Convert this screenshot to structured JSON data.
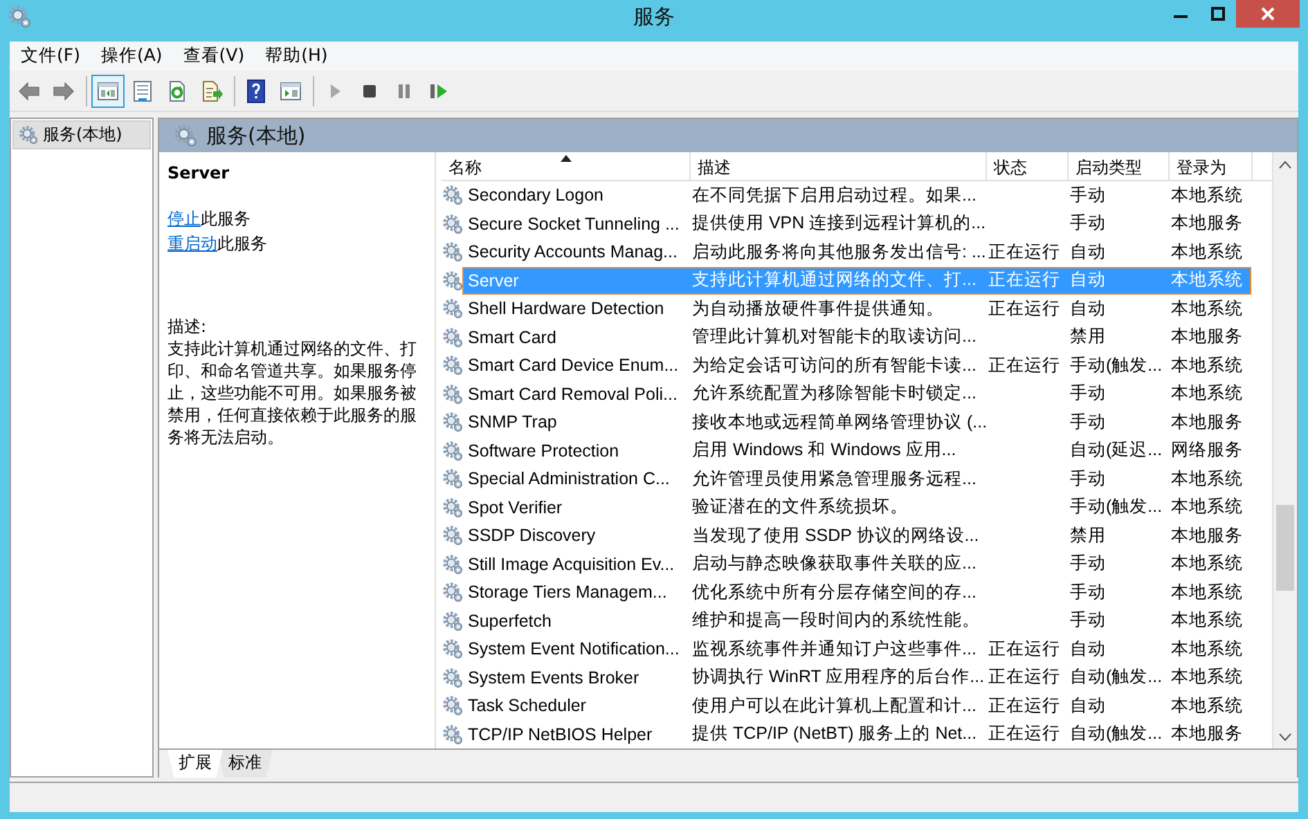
{
  "window": {
    "title": "服务"
  },
  "menu": [
    {
      "label": "文件(F)"
    },
    {
      "label": "操作(A)"
    },
    {
      "label": "查看(V)"
    },
    {
      "label": "帮助(H)"
    }
  ],
  "toolbar": [
    {
      "kind": "back",
      "selected": false
    },
    {
      "kind": "forward",
      "selected": false
    },
    {
      "kind": "tree",
      "selected": true
    },
    {
      "kind": "properties",
      "selected": false
    },
    {
      "kind": "refresh",
      "selected": false
    },
    {
      "kind": "export",
      "selected": false
    },
    {
      "kind": "help",
      "selected": false
    },
    {
      "kind": "console",
      "selected": false
    },
    {
      "kind": "play",
      "selected": false
    },
    {
      "kind": "stop",
      "selected": false
    },
    {
      "kind": "pause",
      "selected": false
    },
    {
      "kind": "resume",
      "selected": false
    }
  ],
  "tree": {
    "items": [
      {
        "label": "服务(本地)",
        "selected": true
      }
    ]
  },
  "panel": {
    "title": "服务(本地)"
  },
  "detail": {
    "service_name": "Server",
    "actions": [
      {
        "link": "停止",
        "text": "此服务"
      },
      {
        "link": "重启动",
        "text": "此服务"
      }
    ],
    "description_label": "描述:",
    "description": "支持此计算机通过网络的文件、打印、和命名管道共享。如果服务停止，这些功能不可用。如果服务被禁用，任何直接依赖于此服务的服务将无法启动。"
  },
  "table": {
    "columns": [
      {
        "label": "名称",
        "sorted": true
      },
      {
        "label": "描述",
        "sorted": false
      },
      {
        "label": "状态",
        "sorted": false
      },
      {
        "label": "启动类型",
        "sorted": false
      },
      {
        "label": "登录为",
        "sorted": false
      }
    ],
    "rows": [
      {
        "name": "Secondary Logon",
        "description": "在不同凭据下启用启动过程。如果...",
        "status": "",
        "startup": "手动",
        "logon": "本地系统",
        "selected": false
      },
      {
        "name": "Secure Socket Tunneling ...",
        "description": "提供使用 VPN 连接到远程计算机的...",
        "status": "",
        "startup": "手动",
        "logon": "本地服务",
        "selected": false
      },
      {
        "name": "Security Accounts Manag...",
        "description": "启动此服务将向其他服务发出信号: ...",
        "status": "正在运行",
        "startup": "自动",
        "logon": "本地系统",
        "selected": false
      },
      {
        "name": "Server",
        "description": "支持此计算机通过网络的文件、打...",
        "status": "正在运行",
        "startup": "自动",
        "logon": "本地系统",
        "selected": true
      },
      {
        "name": "Shell Hardware Detection",
        "description": "为自动播放硬件事件提供通知。",
        "status": "正在运行",
        "startup": "自动",
        "logon": "本地系统",
        "selected": false
      },
      {
        "name": "Smart Card",
        "description": "管理此计算机对智能卡的取读访问...",
        "status": "",
        "startup": "禁用",
        "logon": "本地服务",
        "selected": false
      },
      {
        "name": "Smart Card Device Enum...",
        "description": "为给定会话可访问的所有智能卡读...",
        "status": "正在运行",
        "startup": "手动(触发...",
        "logon": "本地系统",
        "selected": false
      },
      {
        "name": "Smart Card Removal Poli...",
        "description": "允许系统配置为移除智能卡时锁定...",
        "status": "",
        "startup": "手动",
        "logon": "本地系统",
        "selected": false
      },
      {
        "name": "SNMP Trap",
        "description": "接收本地或远程简单网络管理协议 (...",
        "status": "",
        "startup": "手动",
        "logon": "本地服务",
        "selected": false
      },
      {
        "name": "Software Protection",
        "description": "启用 Windows 和 Windows 应用...",
        "status": "",
        "startup": "自动(延迟...",
        "logon": "网络服务",
        "selected": false
      },
      {
        "name": "Special Administration C...",
        "description": "允许管理员使用紧急管理服务远程...",
        "status": "",
        "startup": "手动",
        "logon": "本地系统",
        "selected": false
      },
      {
        "name": "Spot Verifier",
        "description": "验证潜在的文件系统损坏。",
        "status": "",
        "startup": "手动(触发...",
        "logon": "本地系统",
        "selected": false
      },
      {
        "name": "SSDP Discovery",
        "description": "当发现了使用 SSDP 协议的网络设...",
        "status": "",
        "startup": "禁用",
        "logon": "本地服务",
        "selected": false
      },
      {
        "name": "Still Image Acquisition Ev...",
        "description": "启动与静态映像获取事件关联的应...",
        "status": "",
        "startup": "手动",
        "logon": "本地系统",
        "selected": false
      },
      {
        "name": "Storage Tiers Managem...",
        "description": "优化系统中所有分层存储空间的存...",
        "status": "",
        "startup": "手动",
        "logon": "本地系统",
        "selected": false
      },
      {
        "name": "Superfetch",
        "description": "维护和提高一段时间内的系统性能。",
        "status": "",
        "startup": "手动",
        "logon": "本地系统",
        "selected": false
      },
      {
        "name": "System Event Notification...",
        "description": "监视系统事件并通知订户这些事件...",
        "status": "正在运行",
        "startup": "自动",
        "logon": "本地系统",
        "selected": false
      },
      {
        "name": "System Events Broker",
        "description": "协调执行 WinRT 应用程序的后台作...",
        "status": "正在运行",
        "startup": "自动(触发...",
        "logon": "本地系统",
        "selected": false
      },
      {
        "name": "Task Scheduler",
        "description": "使用户可以在此计算机上配置和计...",
        "status": "正在运行",
        "startup": "自动",
        "logon": "本地系统",
        "selected": false
      },
      {
        "name": "TCP/IP NetBIOS Helper",
        "description": "提供 TCP/IP (NetBT) 服务上的 Net...",
        "status": "正在运行",
        "startup": "自动(触发...",
        "logon": "本地服务",
        "selected": false
      }
    ]
  },
  "view_tabs": [
    {
      "label": "扩展",
      "selected": true
    },
    {
      "label": "标准",
      "selected": false
    }
  ]
}
